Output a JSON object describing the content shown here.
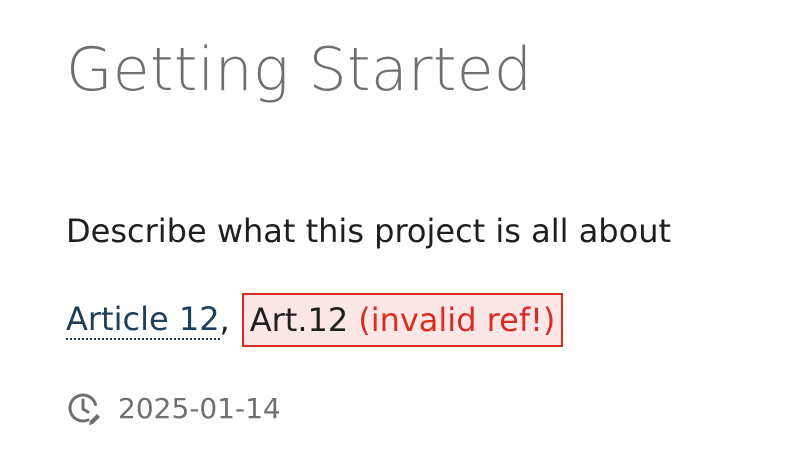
{
  "page": {
    "title": "Getting Started",
    "description": "Describe what this project is all about"
  },
  "references": {
    "valid_link": "Article 12",
    "separator": ",",
    "invalid_ref": "Art.12",
    "invalid_note": "(invalid ref!)"
  },
  "meta": {
    "icon": "clock-edit-icon",
    "date": "2025-01-14"
  },
  "colors": {
    "title": "#6f6f6f",
    "text": "#1f1f1f",
    "link": "#1f3f5a",
    "error": "#da2c23",
    "error_background": "#fde6e6"
  }
}
